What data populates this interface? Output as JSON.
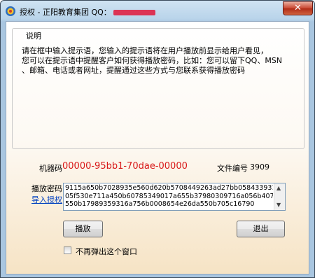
{
  "window": {
    "title": "授权 - 正阳教育集团 QQ：",
    "close_label": "✕"
  },
  "group": {
    "legend": "说明",
    "description": "请在框中输入提示语，您输入的提示语将在用户播放前显示给用户看见，\n您可以在提示语中提醒客户如何获得播放密码，比如：您可以留下QQ、MSN\n、邮箱、电话或者网址，提醒通过这些方式与您联系获得播放密码"
  },
  "machine": {
    "label": "机器码",
    "code": "00000-95bb1-70dae-00000"
  },
  "file": {
    "label": "文件编号",
    "number": "3909"
  },
  "password": {
    "label": "播放密码",
    "import_link": "导入授权",
    "value": "9115a650b7028935e560d620b5708449263ad27bb0584339311a255ba\n05f530e711a450b60785349017a655b37980309716a056b4078234946da\n550b17989359316a756b0008654e26da550b705c16790"
  },
  "buttons": {
    "play": "播放",
    "exit": "退出"
  },
  "checkbox": {
    "label": "不再弹出这个窗口",
    "checked": false
  },
  "colors": {
    "machine_code": "#d81818",
    "link": "#0040c0",
    "close_button": "#c8452f"
  }
}
